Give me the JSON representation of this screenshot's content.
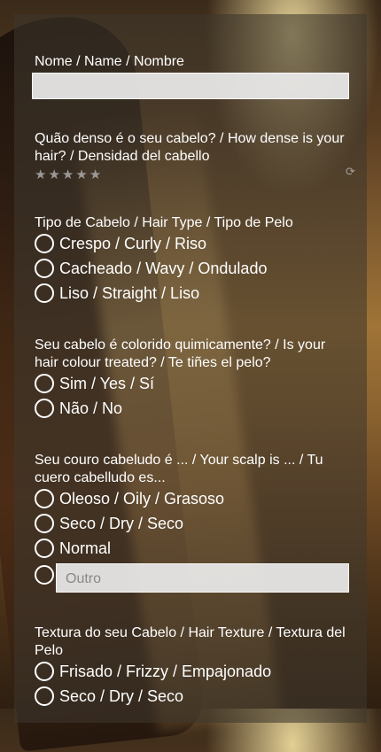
{
  "form": {
    "name": {
      "label": "Nome / Name / Nombre",
      "value": ""
    },
    "density": {
      "label": "Quão denso é o seu cabelo? / How dense is your hair? / Densidad del cabello",
      "rating": 0,
      "max_rating": 5
    },
    "hair_type": {
      "label": "Tipo de Cabelo / Hair Type / Tipo de Pelo",
      "options": [
        "Crespo / Curly / Riso",
        "Cacheado / Wavy / Ondulado",
        "Liso / Straight / Liso"
      ]
    },
    "colour_treated": {
      "label": "Seu cabelo é colorido quimicamente? / Is your hair colour treated? / Te tiñes el pelo?",
      "options": [
        "Sim / Yes / Sí",
        "Não / No"
      ]
    },
    "scalp": {
      "label": "Seu couro cabeludo é ... / Your scalp is ... / Tu cuero cabelludo es...",
      "options": [
        "Oleoso / Oily / Grasoso",
        "Seco / Dry / Seco",
        "Normal"
      ],
      "other_placeholder": "Outro"
    },
    "texture": {
      "label": "Textura do seu Cabelo / Hair Texture / Textura del Pelo",
      "options": [
        "Frisado / Frizzy / Empajonado",
        "Seco / Dry / Seco"
      ]
    }
  },
  "colors": {
    "panel_overlay": "#3e372d",
    "input_bg": "#ececec",
    "text": "#ffffff"
  },
  "icons": {
    "star": "star-icon",
    "clear_rating": "clear-rating-icon"
  }
}
